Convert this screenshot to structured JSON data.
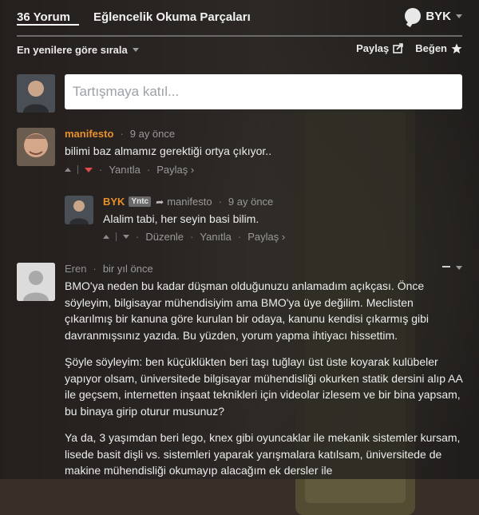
{
  "header": {
    "comment_count_tab": "36 Yorum",
    "site_tab": "Eğlencelik Okuma Parçaları",
    "user": "BYK"
  },
  "toolbar": {
    "sort_label": "En yenilere göre sırala",
    "share_label": "Paylaş",
    "like_label": "Beğen"
  },
  "composer": {
    "placeholder": "Tartışmaya katıl..."
  },
  "comments": [
    {
      "author": "manifesto",
      "time": "9 ay önce",
      "text": "bilimi baz almamız gerektiği ortya çıkıyor..",
      "reply_label": "Yanıtla",
      "share_label": "Paylaş ›"
    },
    {
      "author": "BYK",
      "badge": "Yntc",
      "in_reply_to": "manifesto",
      "time": "9 ay önce",
      "text": "Alalim tabi, her seyin basi bilim.",
      "edit_label": "Düzenle",
      "reply_label": "Yanıtla",
      "share_label": "Paylaş ›"
    },
    {
      "author": "Eren",
      "time": "bir yıl önce",
      "paragraphs": [
        "BMO'ya neden bu kadar düşman olduğunuzu anlamadım açıkçası. Önce söyleyim, bilgisayar mühendisiyim ama BMO'ya üye değilim. Meclisten çıkarılmış bir kanuna göre kurulan bir odaya, kanunu kendisi çıkarmış gibi davranmışsınız yazıda. Bu yüzden, yorum yapma ihtiyacı hissettim.",
        "Şöyle söyleyim: ben küçüklükten beri taşı tuğlayı üst üste koyarak kulübeler yapıyor olsam, üniversitede bilgisayar mühendisliği okurken statik dersini alıp AA ile geçsem, internetten inşaat teknikleri için videolar izlesem ve bir bina yapsam, bu binaya girip oturur musunuz?",
        "Ya da, 3 yaşımdan beri lego, knex gibi oyuncaklar ile mekanik sistemler kursam, lisede basit dişli vs. sistemleri yaparak yarışmalara katılsam, üniversitede de makine mühendisliği okumayıp alacağım ek dersler ile"
      ]
    }
  ],
  "colors": {
    "accent": "#e8912c",
    "downvote": "#e04a4a"
  }
}
